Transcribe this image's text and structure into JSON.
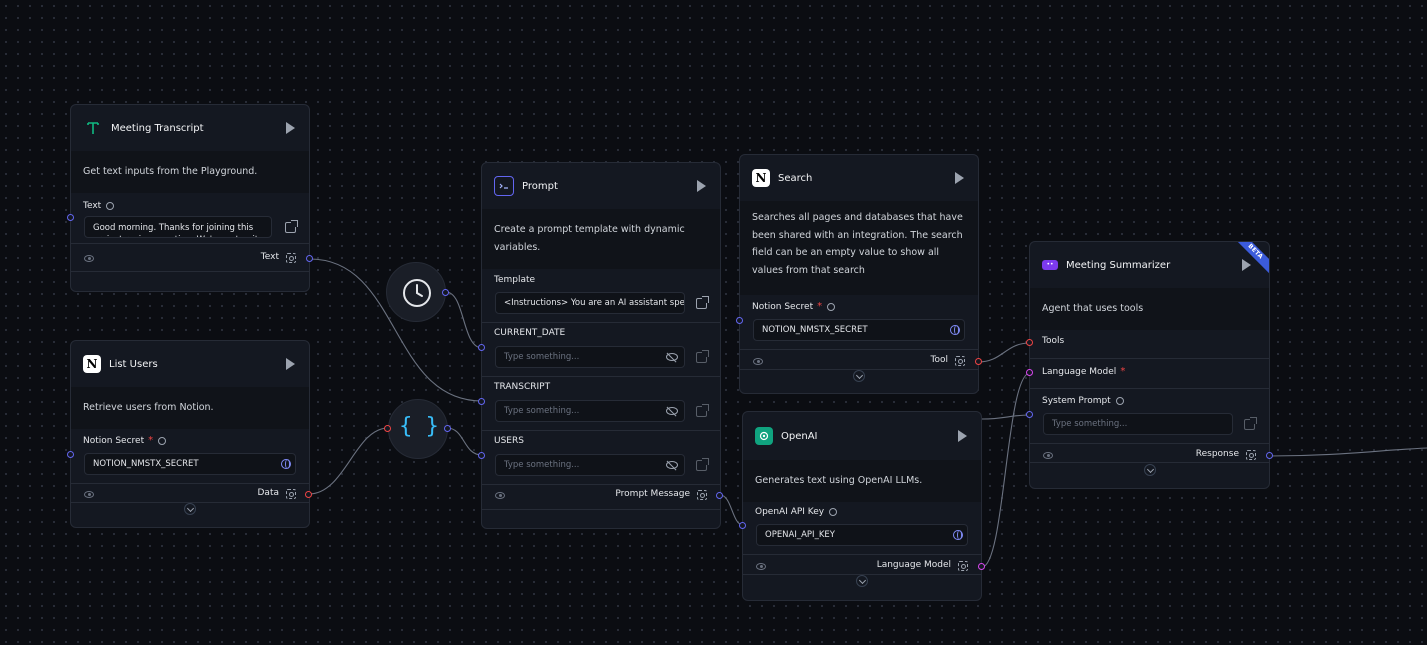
{
  "canvas": {
    "background": "#0b0d12",
    "edge_color": "#6b7280",
    "handle_colors": {
      "input": "#6366f1",
      "data": "#ef4444",
      "model": "#d946ef"
    }
  },
  "nodes": {
    "meeting_transcript": {
      "icon": "text-type-icon",
      "title": "Meeting Transcript",
      "description": "Get text inputs from the Playground.",
      "field_label": "Text",
      "field_value": "Good morning. Thanks for joining this project review meeting. We've got quite a",
      "output_label": "Text"
    },
    "list_users": {
      "icon": "notion-icon",
      "title": "List Users",
      "description": "Retrieve users from Notion.",
      "field_label": "Notion Secret",
      "field_value": "NOTION_NMSTX_SECRET",
      "output_label": "Data"
    },
    "current_date": {
      "icon": "clock-icon"
    },
    "parse_data": {
      "icon": "curly-braces-icon",
      "glyph": "{ }"
    },
    "prompt": {
      "icon": "terminal-icon",
      "title": "Prompt",
      "description": "Create a prompt template with dynamic variables.",
      "template_label": "Template",
      "template_value": "<Instructions> You are an AI assistant speci...",
      "vars": [
        {
          "label": "CURRENT_DATE",
          "placeholder": "Type something..."
        },
        {
          "label": "TRANSCRIPT",
          "placeholder": "Type something..."
        },
        {
          "label": "USERS",
          "placeholder": "Type something..."
        }
      ],
      "output_label": "Prompt Message"
    },
    "search": {
      "icon": "notion-icon",
      "title": "Search",
      "description": "Searches all pages and databases that have been shared with an integration. The search field can be an empty value to show all values from that search",
      "field_label": "Notion Secret",
      "field_value": "NOTION_NMSTX_SECRET",
      "output_label": "Tool"
    },
    "openai": {
      "icon": "openai-icon",
      "title": "OpenAI",
      "description": "Generates text using OpenAI LLMs.",
      "field_label": "OpenAI API Key",
      "field_value": "OPENAI_API_KEY",
      "output_label": "Language Model"
    },
    "meeting_summarizer": {
      "icon": "agent-icon",
      "title": "Meeting Summarizer",
      "badge": "BETA",
      "description": "Agent that uses tools",
      "tools_label": "Tools",
      "model_label": "Language Model",
      "system_prompt_label": "System Prompt",
      "system_prompt_placeholder": "Type something...",
      "output_label": "Response"
    }
  }
}
